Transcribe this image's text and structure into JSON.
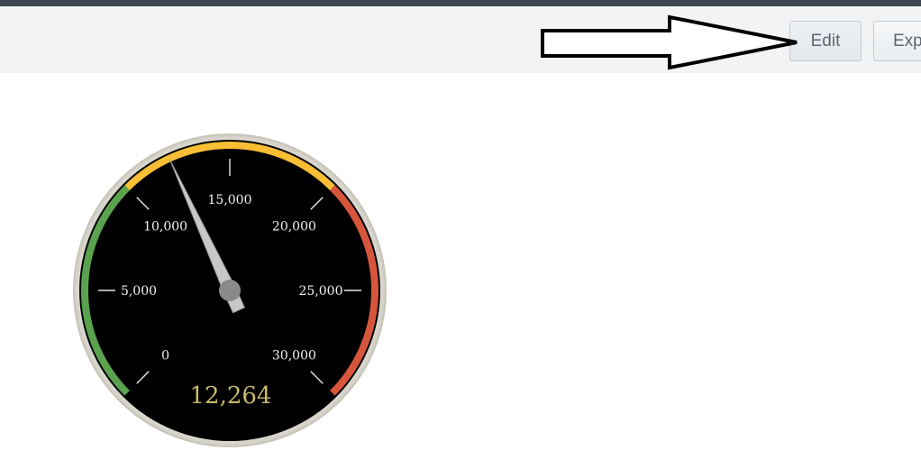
{
  "toolbar": {
    "edit_label": "Edit",
    "export_label": "Export"
  },
  "gauge": {
    "type": "radial-gauge",
    "min": 0,
    "max": 30000,
    "value": 12264,
    "value_label": "12,264",
    "tick_labels": [
      "0",
      "5,000",
      "10,000",
      "15,000",
      "20,000",
      "25,000",
      "30,000"
    ],
    "ranges": [
      {
        "from": 0,
        "to": 10000,
        "color": "#5ba24f"
      },
      {
        "from": 10000,
        "to": 20000,
        "color": "#f8be34"
      },
      {
        "from": 20000,
        "to": 30000,
        "color": "#d6563c"
      }
    ]
  }
}
